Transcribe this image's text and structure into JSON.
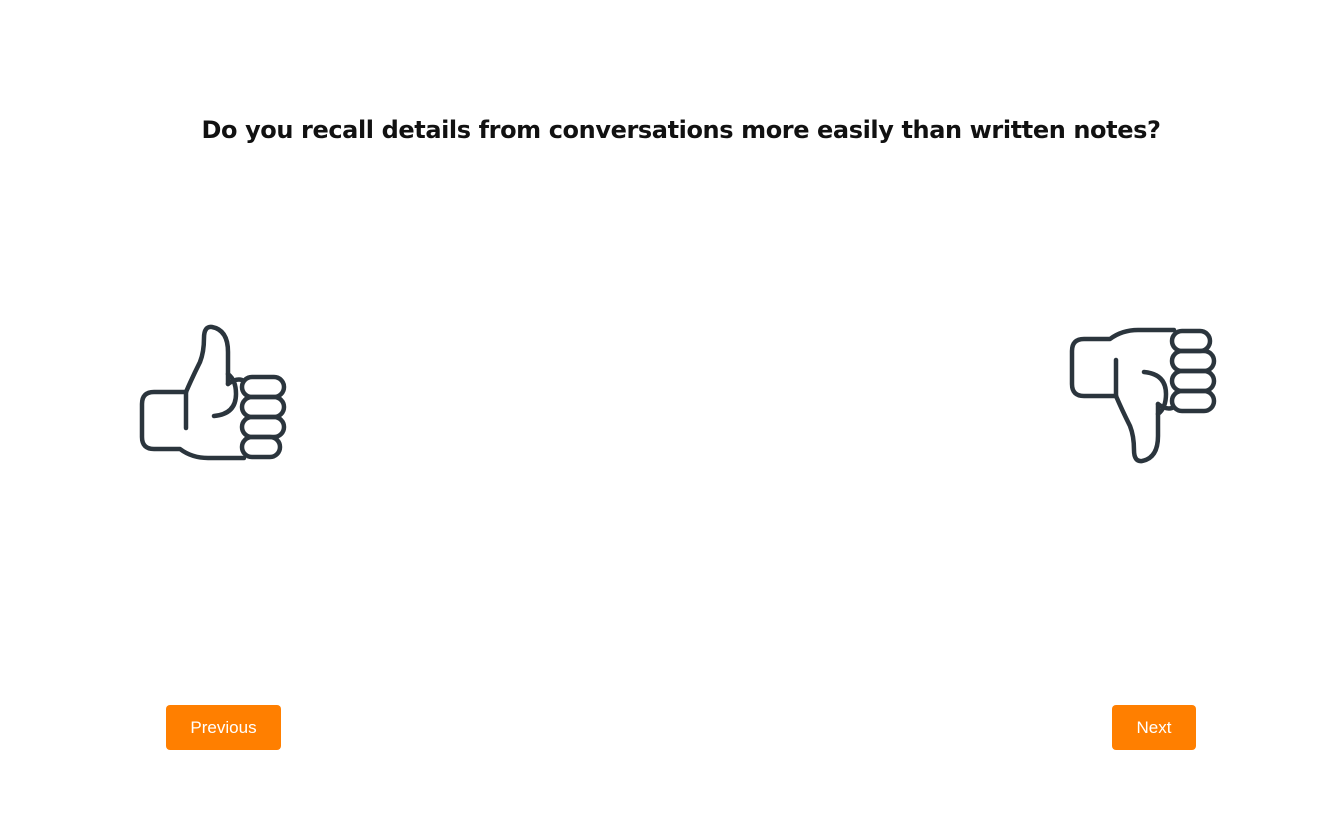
{
  "question": {
    "text": "Do you recall details from conversations more easily than written notes?"
  },
  "answers": {
    "yes_icon": "thumbs-up-icon",
    "no_icon": "thumbs-down-icon"
  },
  "navigation": {
    "previous_label": "Previous",
    "next_label": "Next"
  },
  "colors": {
    "accent": "#ff7f00",
    "icon_stroke": "#2b353d",
    "text": "#111111"
  }
}
